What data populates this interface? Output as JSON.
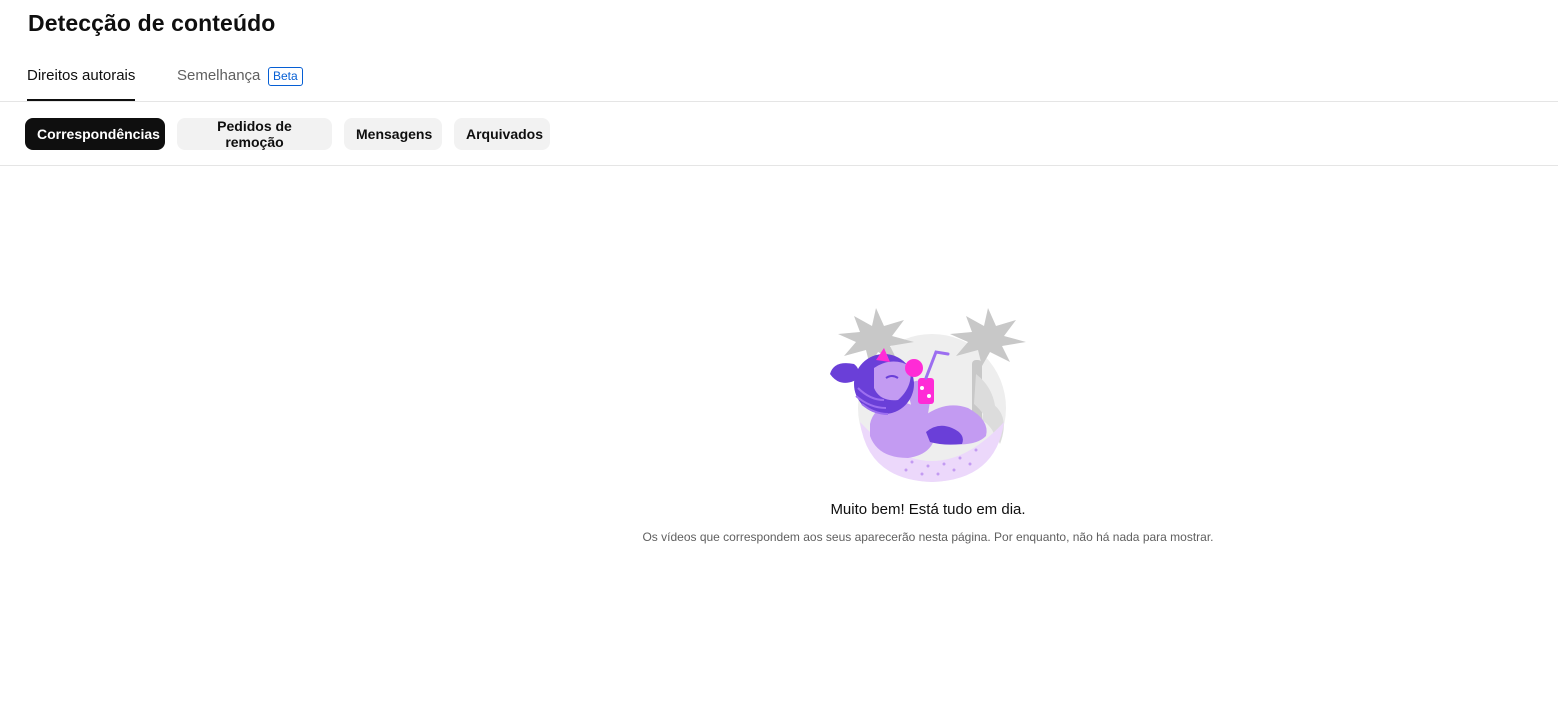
{
  "page": {
    "title": "Detecção de conteúdo"
  },
  "tabs": [
    {
      "label": "Direitos autorais",
      "selected": true
    },
    {
      "label": "Semelhança",
      "badge": "Beta",
      "selected": false
    }
  ],
  "filters": [
    {
      "label": "Correspondências",
      "selected": true
    },
    {
      "label": "Pedidos de remoção",
      "selected": false
    },
    {
      "label": "Mensagens",
      "selected": false
    },
    {
      "label": "Arquivados",
      "selected": false
    }
  ],
  "empty_state": {
    "illustration": "relaxing-person-hammock-illustration",
    "title": "Muito bem! Está tudo em dia.",
    "subtitle": "Os vídeos que correspondem aos seus aparecerão nesta página. Por enquanto, não há nada para mostrar."
  },
  "colors": {
    "text_primary": "#0f0f0f",
    "text_secondary": "#606060",
    "accent_blue": "#065fd4",
    "chip_active_bg": "#0f0f0f",
    "chip_bg": "#f2f2f2",
    "illustration_purple": "#6a3fd8",
    "illustration_lilac": "#c39bf2",
    "illustration_pink": "#ff2bd6"
  }
}
